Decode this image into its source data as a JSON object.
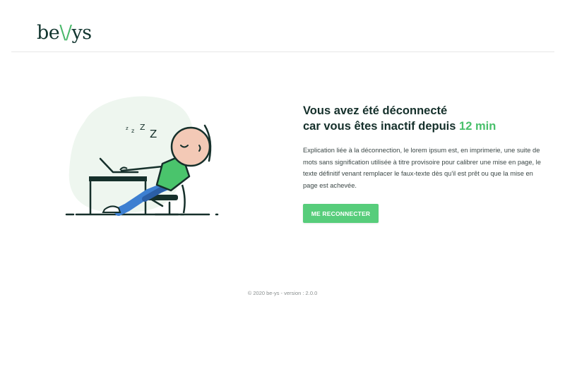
{
  "header": {
    "logo_prefix": "be",
    "logo_accent": "\\/",
    "logo_suffix": "ys"
  },
  "illustration": {
    "sleep_letters": [
      "z",
      "z",
      "Z",
      "Z"
    ]
  },
  "main": {
    "title_line1": "Vous avez été déconnecté",
    "title_line2_prefix": "car vous êtes inactif depuis",
    "title_line2_highlight": "12 min",
    "description": "Explication liée à la déconnection, le lorem ipsum est, en imprimerie, une suite de mots sans signification utilisée à titre provisoire pour calibrer une mise en page, le texte définitif venant remplacer le faux-texte dès qu'il est prêt ou que la mise en page est achevée.",
    "button_label": "ME RECONNECTER"
  },
  "footer": {
    "text": "© 2020 be-ys - version : 2.0.0"
  },
  "colors": {
    "brand_green": "#57cd7b",
    "highlight_green": "#49c06b",
    "dark_text": "#15302b",
    "blob_bg": "#eef6ef"
  }
}
